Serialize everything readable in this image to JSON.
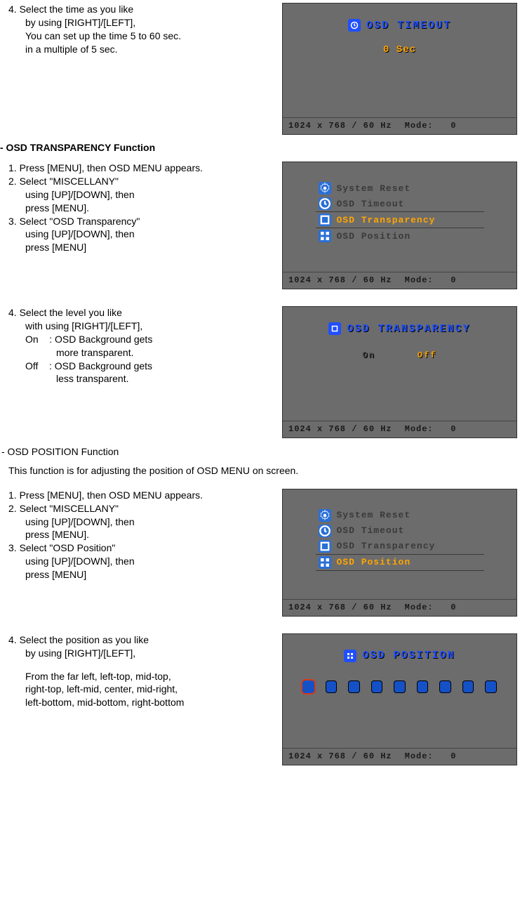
{
  "step_timeout": {
    "num": "4.",
    "l1": "Select the time as you like",
    "l2": "by using [RIGHT]/[LEFT],",
    "l3": "You can set up the time 5 to 60 sec.",
    "l4": "in a multiple of 5 sec."
  },
  "shot_timeout": {
    "title": "OSD  TIMEOUT",
    "value": "0 Sec"
  },
  "heading_transparency": "- OSD TRANSPARENCY Function",
  "steps_trans_a": {
    "n1": "1.",
    "t1": "Press [MENU], then OSD MENU appears.",
    "n2": "2.",
    "t2": "Select \"MISCELLANY\"",
    "t2b": "using [UP]/[DOWN], then",
    "t2c": "press  [MENU].",
    "n3": "3.",
    "t3": "Select \"OSD Transparency\"",
    "t3b": "using [UP]/[DOWN], then",
    "t3c": "press  [MENU]"
  },
  "menu_trans": {
    "items": [
      {
        "label": "System Reset",
        "icon": "gear"
      },
      {
        "label": "OSD Timeout",
        "icon": "clock"
      },
      {
        "label": "OSD Transparency",
        "icon": "square"
      },
      {
        "label": "OSD Position",
        "icon": "grid"
      }
    ],
    "selected_index": 2
  },
  "step_trans_b": {
    "num": "4.",
    "l1": "Select the level you like",
    "l2": "with using [RIGHT]/[LEFT],",
    "on_label": "On",
    "on_desc1": ": OSD Background gets",
    "on_desc2": "more transparent.",
    "off_label": "Off",
    "off_desc1": ": OSD Background gets",
    "off_desc2": "less transparent."
  },
  "shot_trans": {
    "title": "OSD  TRANSPARENCY",
    "opt_on": "On",
    "opt_off": "Off"
  },
  "heading_position": "- OSD POSITION Function",
  "position_desc": "This function is for adjusting the position of  OSD MENU on screen.",
  "steps_pos_a": {
    "n1": "1.",
    "t1": "Press [MENU], then OSD MENU appears.",
    "n2": "2.",
    "t2": "Select \"MISCELLANY\"",
    "t2b": "using [UP]/[DOWN], then",
    "t2c": "press  [MENU].",
    "n3": "3.",
    "t3": "Select \"OSD Position\"",
    "t3b": "using [UP]/[DOWN], then",
    "t3c": "press  [MENU]"
  },
  "menu_pos": {
    "items": [
      {
        "label": "System Reset",
        "icon": "gear"
      },
      {
        "label": "OSD Timeout",
        "icon": "clock"
      },
      {
        "label": "OSD Transparency",
        "icon": "square"
      },
      {
        "label": "OSD Position",
        "icon": "grid"
      }
    ],
    "selected_index": 3
  },
  "step_pos_b": {
    "num": "4.",
    "l1": "Select the position as you like",
    "l2": "by using [RIGHT]/[LEFT],",
    "l3": "From the far left, left-top, mid-top,",
    "l4": "right-top, left-mid, center, mid-right,",
    "l5": "left-bottom, mid-bottom, right-bottom"
  },
  "shot_pos": {
    "title": "OSD  POSITION",
    "count": 9,
    "selected": 0
  },
  "footer": {
    "res": "1024  x   768  /   60  Hz",
    "mode_label": "Mode:",
    "mode_val": "0"
  }
}
